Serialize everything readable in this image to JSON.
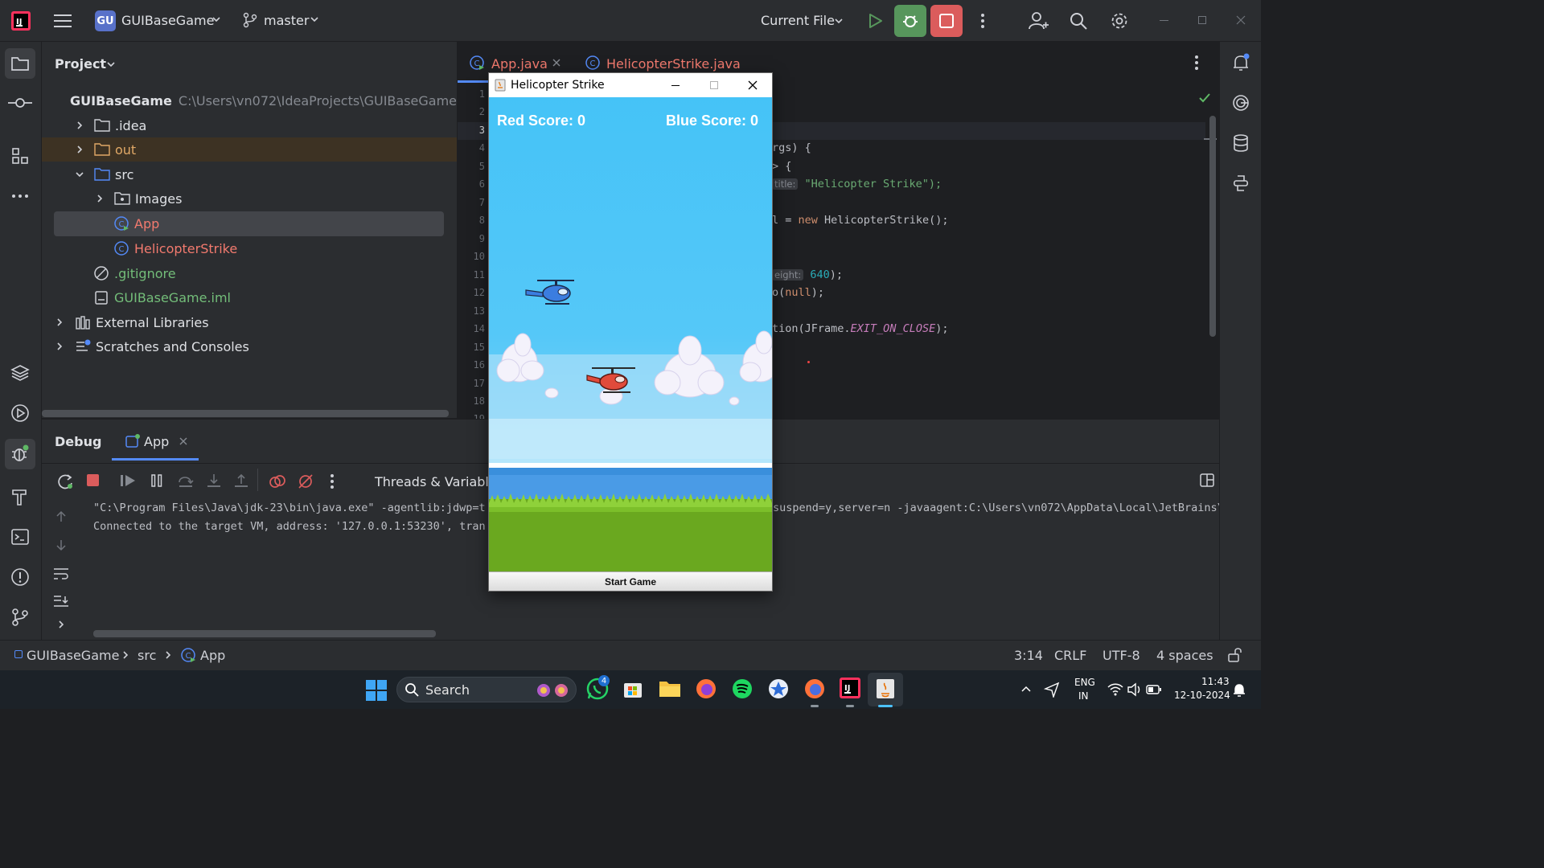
{
  "topbar": {
    "project_badge": "GU",
    "project_name": "GUIBaseGame",
    "branch": "master",
    "run_config": "Current File"
  },
  "project_panel": {
    "title": "Project",
    "root_name": "GUIBaseGame",
    "root_path": "C:\\Users\\vn072\\IdeaProjects\\GUIBaseGame",
    "items": [
      {
        "label": ".idea"
      },
      {
        "label": "out"
      },
      {
        "label": "src"
      },
      {
        "label": "Images"
      },
      {
        "label": "App"
      },
      {
        "label": "HelicopterStrike"
      },
      {
        "label": ".gitignore"
      },
      {
        "label": "GUIBaseGame.iml"
      },
      {
        "label": "External Libraries"
      },
      {
        "label": "Scratches and Consoles"
      }
    ]
  },
  "editor": {
    "tabs": [
      {
        "label": "App.java"
      },
      {
        "label": "HelicopterStrike.java"
      }
    ],
    "line_numbers": [
      "1",
      "2",
      "3",
      "4",
      "5",
      "6",
      "7",
      "8",
      "9",
      "10",
      "11",
      "12",
      "13",
      "14",
      "15",
      "16",
      "17",
      "18",
      "19"
    ],
    "code": {
      "l4": "rgs) {",
      "l5": "> {",
      "l6_hint": "title:",
      "l6": "\"Helicopter Strike\");",
      "l8a": "l = ",
      "l8_kw": "new",
      "l8b": " HelicopterStrike();",
      "l11_hint": "eight:",
      "l11_num": "640",
      "l11b": ");",
      "l12a": "o(",
      "l12_kw": "null",
      "l12b": ");",
      "l14a": "tion(JFrame.",
      "l14_const": "EXIT_ON_CLOSE",
      "l14b": ");"
    }
  },
  "debug": {
    "title": "Debug",
    "tab": "App",
    "threads_label": "Threads & Variables",
    "console": [
      "\"C:\\Program Files\\Java\\jdk-23\\bin\\java.exe\" -agentlib:jdwp=t",
      "Connected to the target VM, address: '127.0.0.1:53230', tran"
    ],
    "console_right": "suspend=y,server=n -javaagent:C:\\Users\\vn072\\AppData\\Local\\JetBrains\\"
  },
  "statusbar": {
    "breadcrumb": [
      "GUIBaseGame",
      "src",
      "App"
    ],
    "position": "3:14",
    "line_sep": "CRLF",
    "encoding": "UTF-8",
    "indent": "4 spaces"
  },
  "game": {
    "window_title": "Helicopter Strike",
    "red_score": "Red Score: 0",
    "blue_score": "Blue Score: 0",
    "start_button": "Start Game",
    "sky_color": "#45c3f7",
    "grass_color": "#6aa81f"
  },
  "taskbar": {
    "search": "Search",
    "whatsapp_badge": "4",
    "lang_top": "ENG",
    "lang_bottom": "IN",
    "time": "11:43",
    "date": "12-10-2024"
  }
}
